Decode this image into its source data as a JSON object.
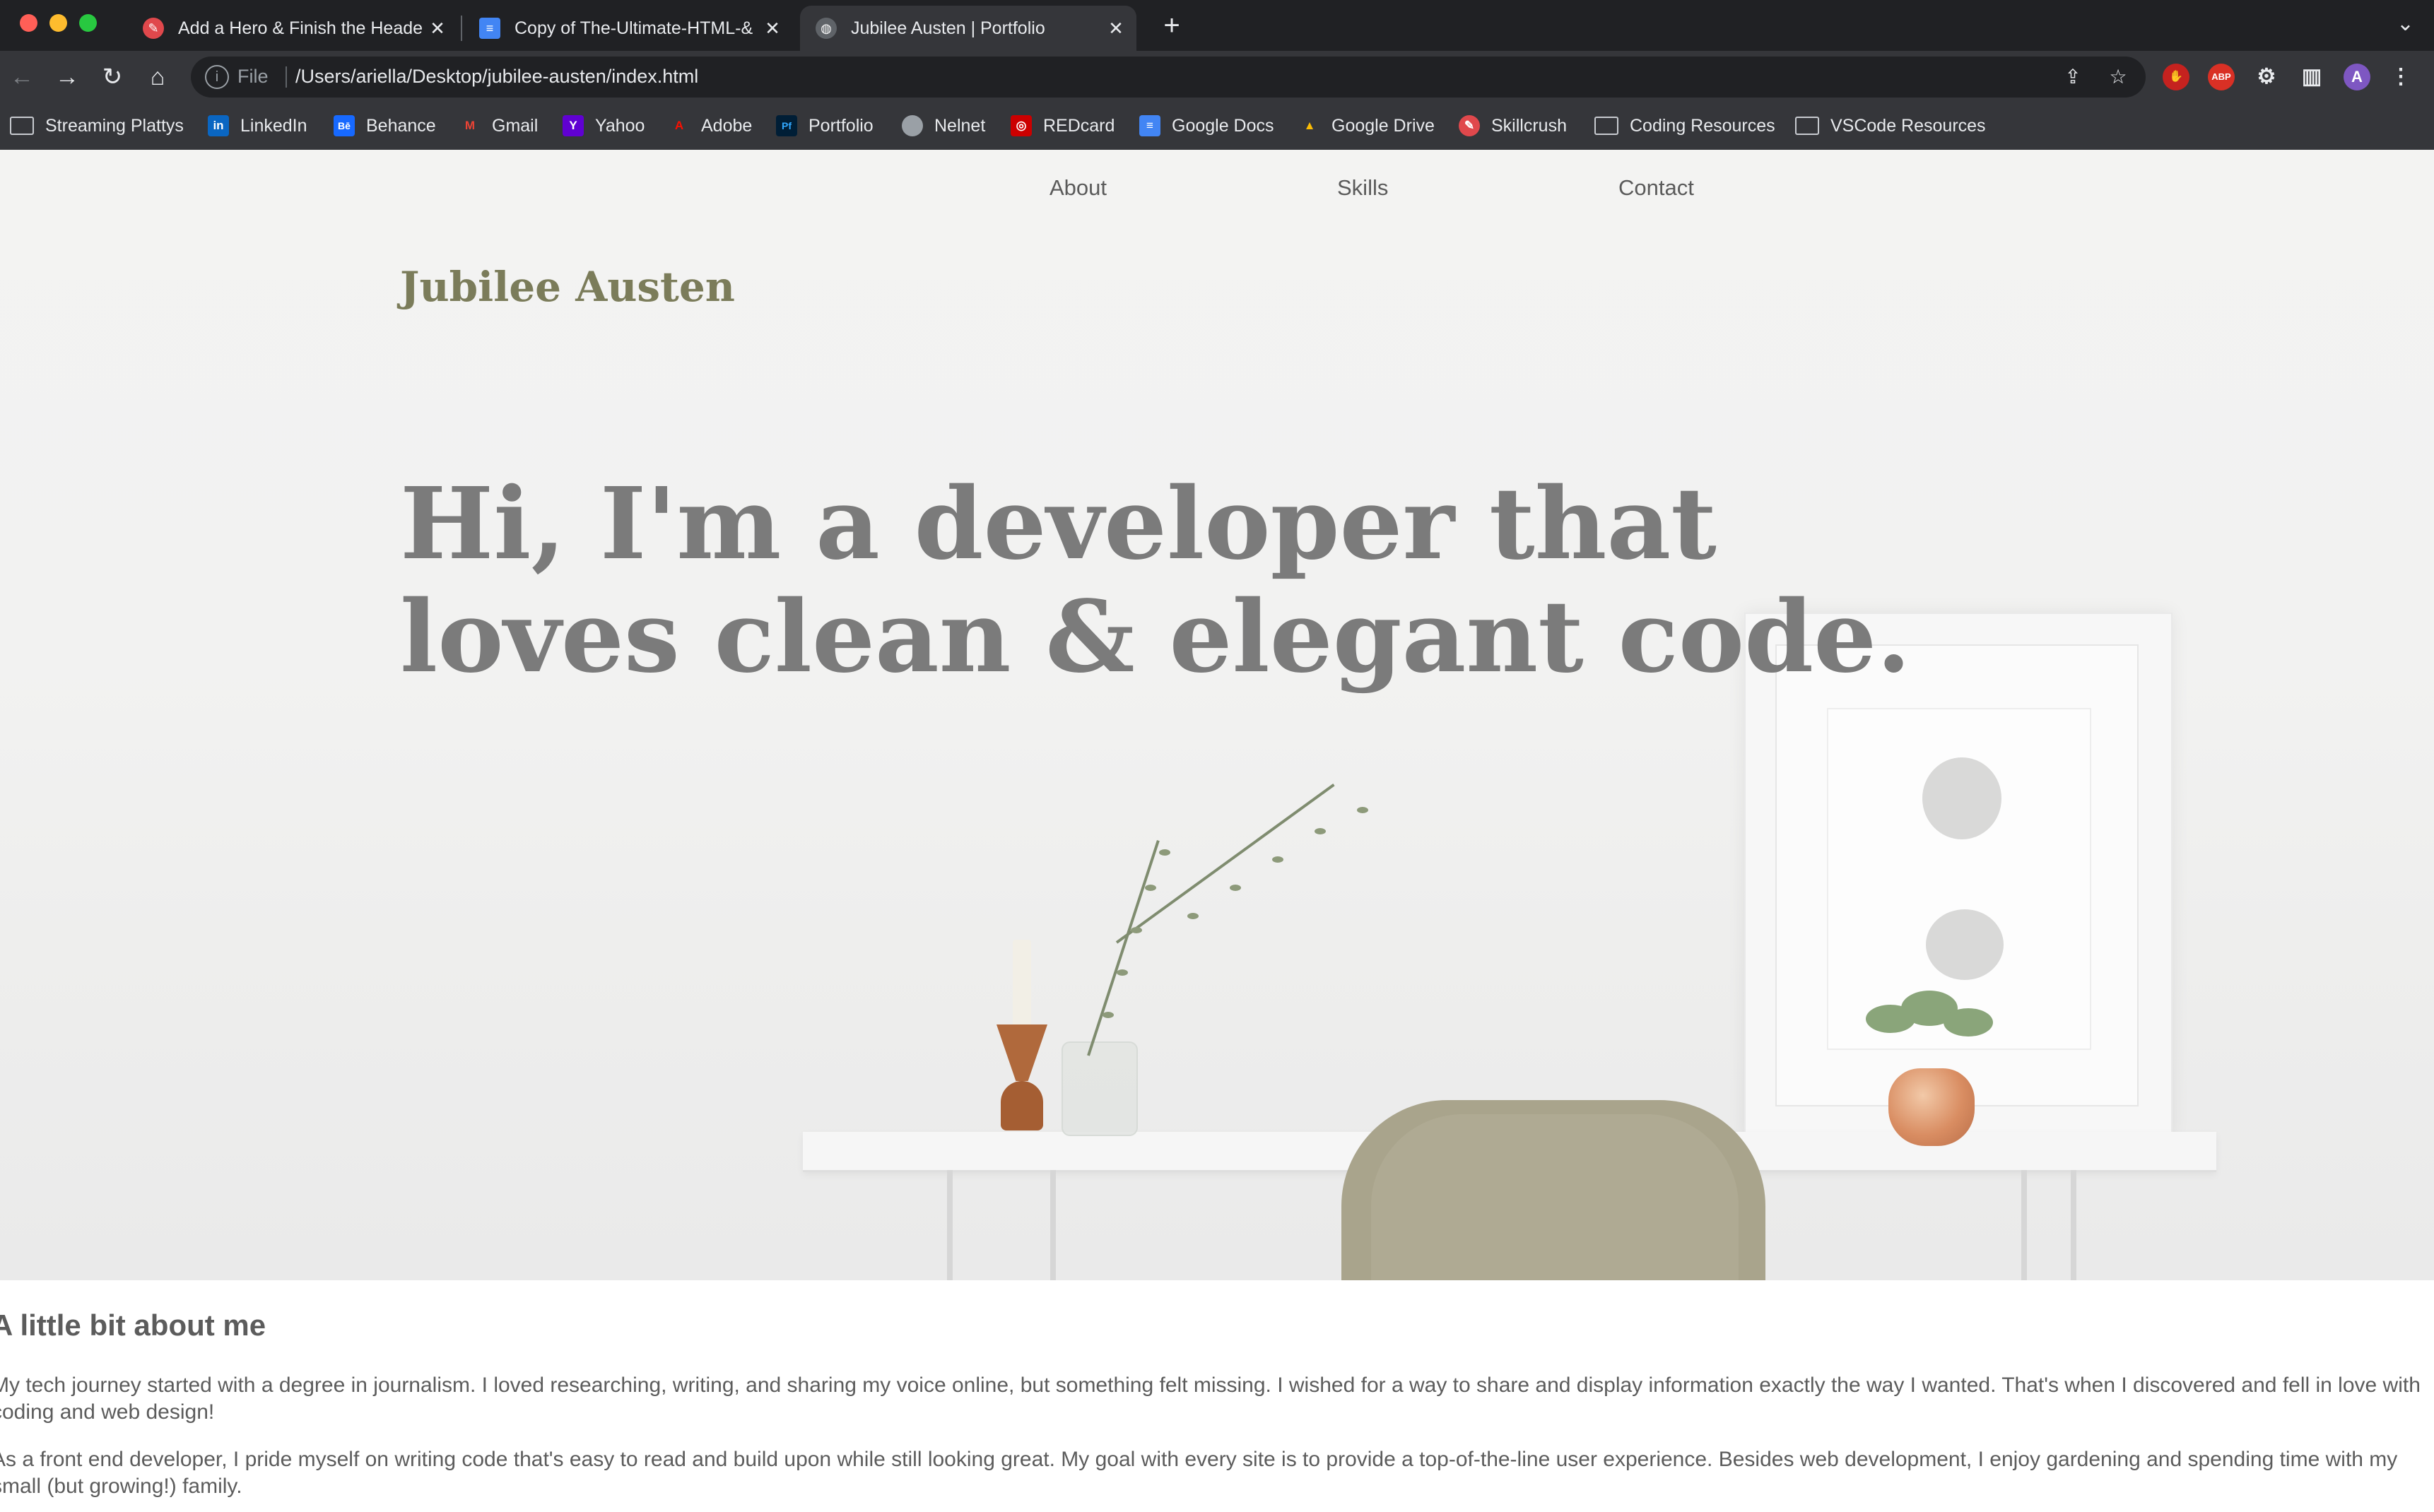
{
  "browser": {
    "tabs": [
      {
        "title": "Add a Hero & Finish the Heade",
        "icon": "skillcrush-icon"
      },
      {
        "title": "Copy of The-Ultimate-HTML-&",
        "icon": "google-docs-icon"
      },
      {
        "title": "Jubilee Austen | Portfolio",
        "icon": "globe-icon",
        "active": true
      }
    ],
    "address": {
      "scheme_label": "File",
      "url": "/Users/ariella/Desktop/jubilee-austen/index.html"
    },
    "profile_initial": "A",
    "adblock_label": "ABP",
    "bookmarks": [
      {
        "label": "Streaming Plattys",
        "icon": "folder-icon"
      },
      {
        "label": "LinkedIn",
        "icon": "linkedin-icon",
        "glyph": "in"
      },
      {
        "label": "Behance",
        "icon": "behance-icon",
        "glyph": "Bē"
      },
      {
        "label": "Gmail",
        "icon": "gmail-icon",
        "glyph": "M"
      },
      {
        "label": "Yahoo",
        "icon": "yahoo-icon",
        "glyph": "Y"
      },
      {
        "label": "Adobe",
        "icon": "adobe-icon",
        "glyph": "A"
      },
      {
        "label": "Portfolio",
        "icon": "portfolio-icon",
        "glyph": "Pf"
      },
      {
        "label": "Nelnet",
        "icon": "nelnet-icon",
        "glyph": ""
      },
      {
        "label": "REDcard",
        "icon": "redcard-icon",
        "glyph": "◎"
      },
      {
        "label": "Google Docs",
        "icon": "google-docs-icon",
        "glyph": "≡"
      },
      {
        "label": "Google Drive",
        "icon": "google-drive-icon",
        "glyph": "▲"
      },
      {
        "label": "Skillcrush",
        "icon": "skillcrush-icon",
        "glyph": "✎"
      },
      {
        "label": "Coding Resources",
        "icon": "folder-icon"
      },
      {
        "label": "VSCode Resources",
        "icon": "folder-icon"
      }
    ]
  },
  "site": {
    "nav": [
      "About",
      "Skills",
      "Contact"
    ],
    "name": "Jubilee Austen",
    "headline": "Hi, I'm a developer that loves clean & elegant code.",
    "about": {
      "heading": "A little bit about me",
      "paragraphs": [
        "My tech journey started with a degree in journalism. I loved researching, writing, and sharing my voice online, but something felt missing. I wished for a way to share and display information exactly the way I wanted. That's when I discovered and fell in love with coding and web design!",
        "As a front end developer, I pride myself on writing code that's easy to read and build upon while still looking great. My goal with every site is to provide a top-of-the-line user experience. Besides web development, I enjoy gardening and spending time with my small (but growing!) family."
      ]
    }
  },
  "colors": {
    "chrome_dark": "#202124",
    "chrome_toolbar": "#35363a",
    "site_name": "#7b7c5a",
    "headline": "#7b7b7b",
    "body_text": "#5c5c5c"
  }
}
